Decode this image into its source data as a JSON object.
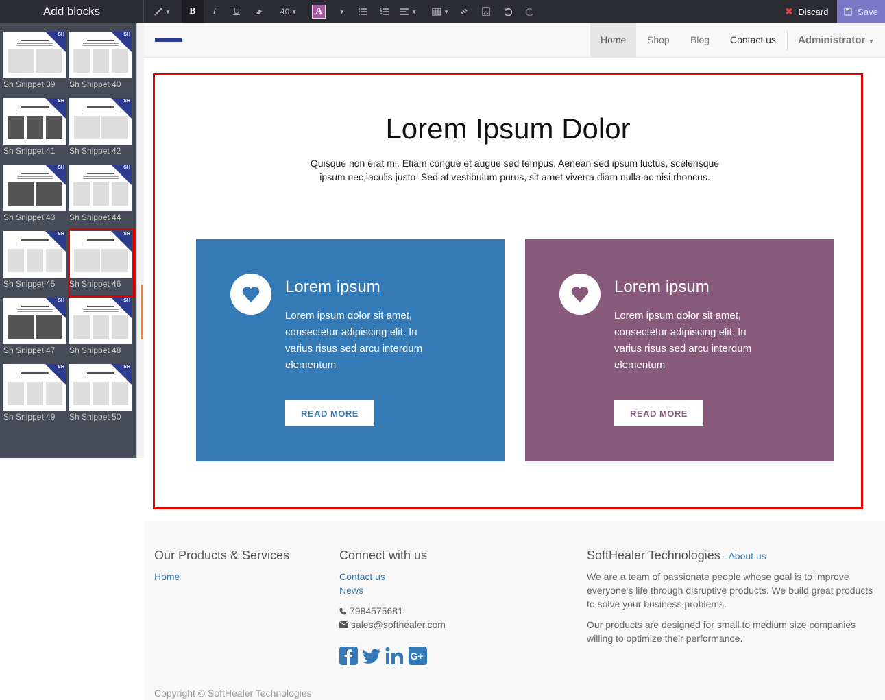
{
  "sidebar": {
    "title": "Add blocks",
    "snippets": [
      "Sh Snippet 39",
      "Sh Snippet 40",
      "Sh Snippet 41",
      "Sh Snippet 42",
      "Sh Snippet 43",
      "Sh Snippet 44",
      "Sh Snippet 45",
      "Sh Snippet 46",
      "Sh Snippet 47",
      "Sh Snippet 48",
      "Sh Snippet 49",
      "Sh Snippet 50"
    ],
    "badge": "SH",
    "selected": "Sh Snippet 46"
  },
  "toolbar": {
    "font_size": "40",
    "color_letter": "A",
    "discard_label": "Discard",
    "save_label": "Save",
    "accent_save": "#7a78c6",
    "accent_discard": "#e04848"
  },
  "navbar": {
    "items": [
      "Home",
      "Shop",
      "Blog",
      "Contact us"
    ],
    "active": "Home",
    "user": "Administrator"
  },
  "section": {
    "title": "Lorem Ipsum Dolor",
    "subtitle": "Quisque non erat mi. Etiam congue et augue sed tempus. Aenean sed ipsum luctus, scelerisque ipsum nec,iaculis justo. Sed at vestibulum purus, sit amet viverra diam nulla ac nisi rhoncus.",
    "cards": [
      {
        "title": "Lorem ipsum",
        "text": "Lorem ipsum dolor sit amet, consectetur adipiscing elit. In varius risus sed arcu interdum elementum",
        "button": "READ MORE",
        "color": "#337ab7"
      },
      {
        "title": "Lorem ipsum",
        "text": "Lorem ipsum dolor sit amet, consectetur adipiscing elit. In varius risus sed arcu interdum elementum",
        "button": "READ MORE",
        "color": "#875a7b"
      }
    ]
  },
  "footer": {
    "col1": {
      "heading": "Our Products & Services",
      "links": [
        "Home"
      ]
    },
    "col2": {
      "heading": "Connect with us",
      "links": [
        "Contact us",
        "News"
      ],
      "phone": "7984575681",
      "email": "sales@softhealer.com"
    },
    "col3": {
      "heading": "SoftHealer Technologies",
      "about_sep": " - ",
      "about_link": "About us",
      "p1": "We are a team of passionate people whose goal is to improve everyone's life through disruptive products. We build great products to solve your business problems.",
      "p2": "Our products are designed for small to medium size companies willing to optimize their performance."
    },
    "social": [
      "facebook-icon",
      "twitter-icon",
      "linkedin-icon",
      "google-plus-icon"
    ],
    "copyright": "Copyright © SoftHealer Technologies"
  }
}
